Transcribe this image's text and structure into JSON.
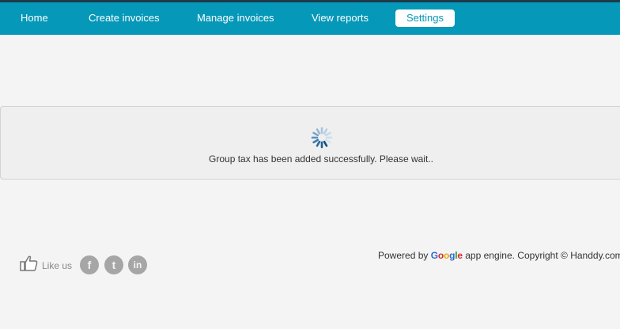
{
  "nav": {
    "items": [
      {
        "label": "Home"
      },
      {
        "label": "Create invoices"
      },
      {
        "label": "Manage invoices"
      },
      {
        "label": "View reports"
      },
      {
        "label": "Settings",
        "active": true
      }
    ]
  },
  "message": {
    "text": "Group tax has been added successfully. Please wait.."
  },
  "footer": {
    "like_label": "Like us",
    "social": [
      {
        "name": "facebook",
        "glyph": "f"
      },
      {
        "name": "twitter",
        "glyph": "t"
      },
      {
        "name": "linkedin",
        "glyph": "in"
      }
    ],
    "powered_by": "Powered by",
    "google_letters": [
      "G",
      "o",
      "o",
      "g",
      "l",
      "e"
    ],
    "after_google": "app engine. Copyright",
    "copyright_symbol": "©",
    "company": "Handdy.com"
  },
  "colors": {
    "nav_bg": "#0598b8",
    "nav_top_border": "#1d3a4a",
    "page_bg": "#f4f4f4",
    "google_blue": "#3366cc",
    "google_red": "#d62b2b",
    "google_yellow": "#e8a800",
    "google_green": "#2a9a3a"
  }
}
